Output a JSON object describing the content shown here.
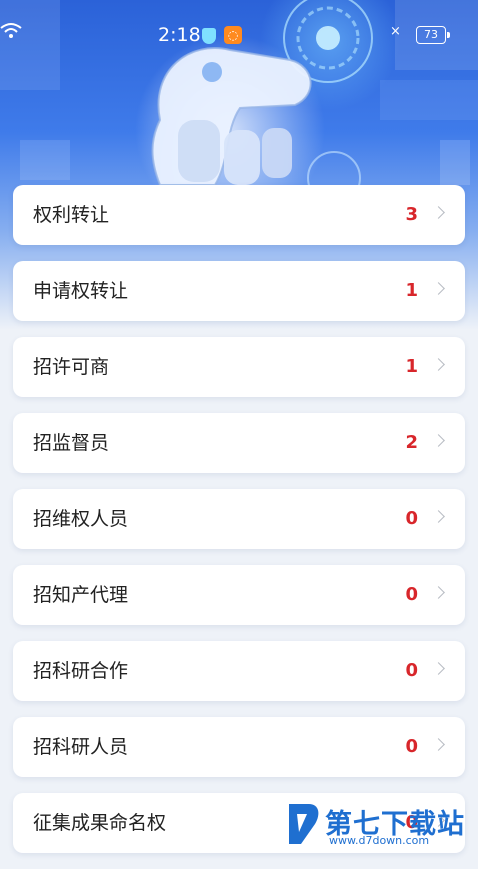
{
  "status_bar": {
    "time": "2:18",
    "app_badge_text": "◌",
    "battery_level": "73"
  },
  "hero": {
    "image": "robot-arm-illustration"
  },
  "items": [
    {
      "label": "权利转让",
      "count": "3"
    },
    {
      "label": "申请权转让",
      "count": "1"
    },
    {
      "label": "招许可商",
      "count": "1"
    },
    {
      "label": "招监督员",
      "count": "2"
    },
    {
      "label": "招维权人员",
      "count": "0"
    },
    {
      "label": "招知产代理",
      "count": "0"
    },
    {
      "label": "招科研合作",
      "count": "0"
    },
    {
      "label": "招科研人员",
      "count": "0"
    },
    {
      "label": "征集成果命名权",
      "count": "0"
    }
  ],
  "watermark": {
    "title": "第七下载站",
    "url": "www.d7down.com"
  },
  "colors": {
    "count": "#d8262b",
    "hero_blue": "#2b62d8",
    "watermark_blue": "#1f6fd0"
  }
}
